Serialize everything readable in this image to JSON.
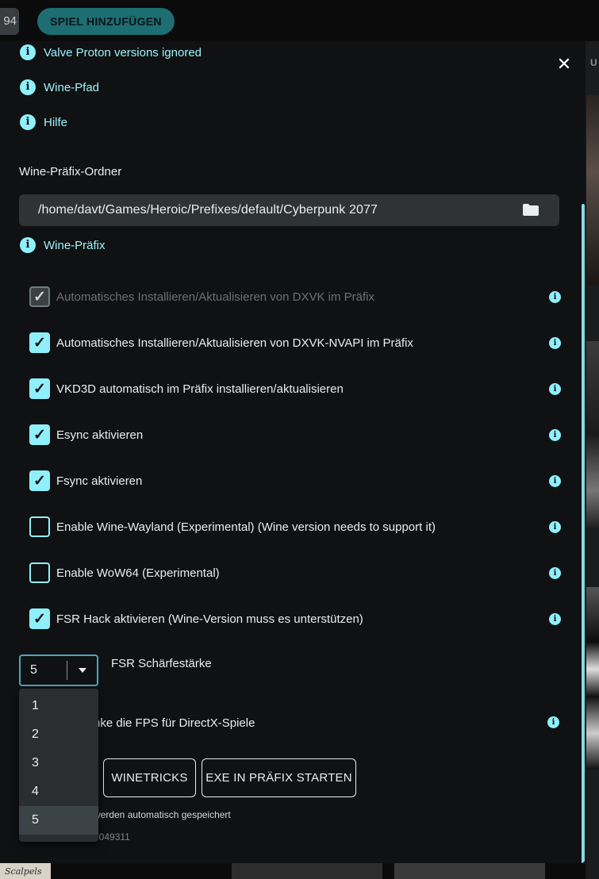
{
  "topbar": {
    "badge_text": "94",
    "add_game_label": "SPIEL HINZUFÜGEN",
    "right_edge_text": "U"
  },
  "bottom_covers": {
    "b1_text": "Scalpels"
  },
  "dialog": {
    "close_icon": "close-icon",
    "info_links": [
      {
        "label": "Valve Proton versions ignored"
      },
      {
        "label": "Wine-Pfad"
      },
      {
        "label": "Hilfe"
      }
    ],
    "prefix_folder_label": "Wine-Präfix-Ordner",
    "prefix_path": "/home/davt/Games/Heroic/Prefixes/default/Cyberpunk 2077",
    "prefix_link_label": "Wine-Präfix",
    "checkboxes": [
      {
        "label": "Automatisches Installieren/Aktualisieren von DXVK im Präfix",
        "checked": true,
        "disabled": true
      },
      {
        "label": "Automatisches Installieren/Aktualisieren von DXVK-NVAPI im Präfix",
        "checked": true,
        "disabled": false
      },
      {
        "label": "VKD3D automatisch im Präfix installieren/aktualisieren",
        "checked": true,
        "disabled": false
      },
      {
        "label": "Esync aktivieren",
        "checked": true,
        "disabled": false
      },
      {
        "label": "Fsync aktivieren",
        "checked": true,
        "disabled": false
      },
      {
        "label": "Enable Wine-Wayland (Experimental) (Wine version needs to support it)",
        "checked": false,
        "disabled": false
      },
      {
        "label": "Enable WoW64 (Experimental)",
        "checked": false,
        "disabled": false
      },
      {
        "label": "FSR Hack aktivieren (Wine-Version muss es unterstützen)",
        "checked": true,
        "disabled": false
      }
    ],
    "fsr_select": {
      "value": "5",
      "label": "FSR Schärfestärke",
      "options": [
        "1",
        "2",
        "3",
        "4",
        "5"
      ]
    },
    "fps_label_partial": "nke die FPS für DirectX-Spiele",
    "buttons": {
      "winetricks": "WINETRICKS",
      "exe": "EXE IN PRÄFIX STARTEN"
    },
    "autosave_hint_partial": "werden automatisch gespeichert",
    "version_partial": "3049311"
  },
  "colors": {
    "accent": "#8ff0fb",
    "dialog_bg": "#0f1112",
    "field_bg": "#2f3335",
    "add_game_bg": "#1d6d73"
  }
}
